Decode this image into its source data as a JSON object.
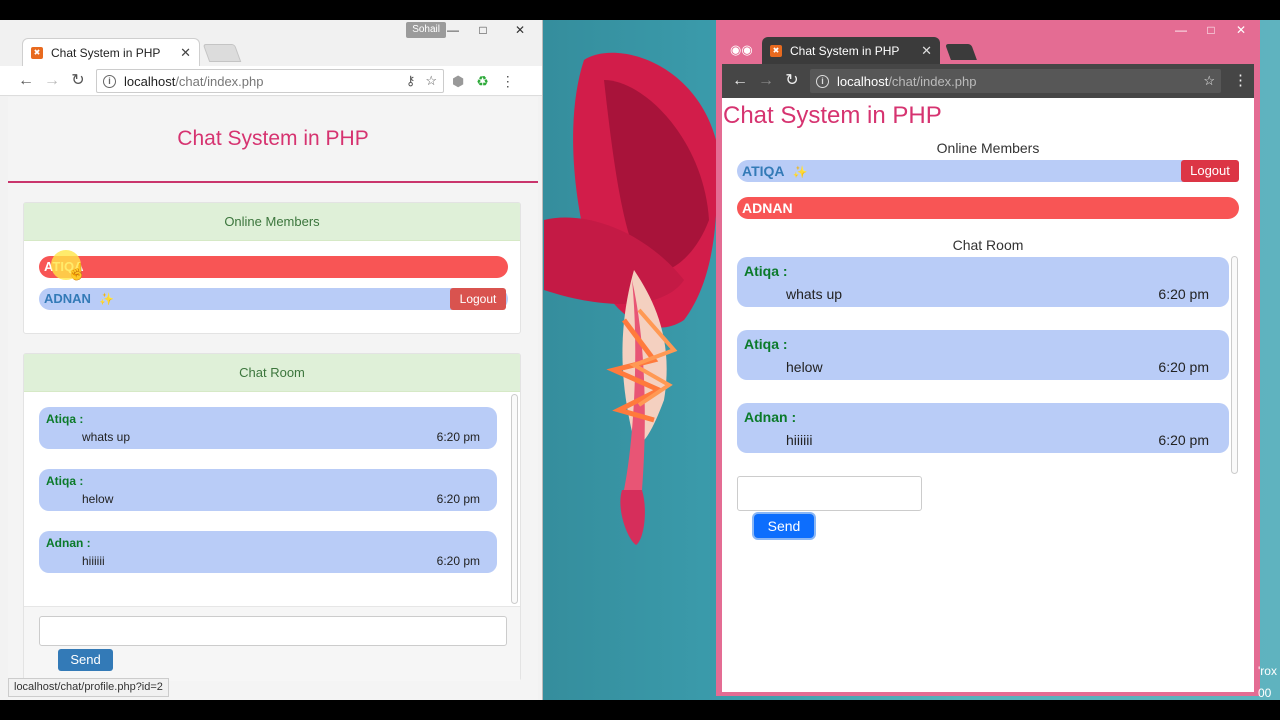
{
  "left_window": {
    "user_badge": "Sohail",
    "tab_title": "Chat System in PHP",
    "url_host": "localhost",
    "url_path": "/chat/index.php",
    "page_title": "Chat System in PHP",
    "online_header": "Online Members",
    "members": [
      {
        "name": "ATIQA"
      },
      {
        "name": "ADNAN"
      }
    ],
    "logout_label": "Logout",
    "chat_header": "Chat Room",
    "messages": [
      {
        "sender": "Atiqa :",
        "text": "whats up",
        "time": "6:20 pm"
      },
      {
        "sender": "Atiqa :",
        "text": "helow",
        "time": "6:20 pm"
      },
      {
        "sender": "Adnan :",
        "text": "hiiiiii",
        "time": "6:20 pm"
      }
    ],
    "send_label": "Send",
    "status_url": "localhost/chat/profile.php?id=2"
  },
  "right_window": {
    "tab_title": "Chat System in PHP",
    "url_host": "localhost",
    "url_path": "/chat/index.php",
    "page_title": "Chat System in PHP",
    "online_header": "Online Members",
    "members": [
      {
        "name": "ATIQA"
      },
      {
        "name": "ADNAN"
      }
    ],
    "logout_label": "Logout",
    "chat_header": "Chat Room",
    "messages": [
      {
        "sender": "Atiqa :",
        "text": "whats up",
        "time": "6:20 pm"
      },
      {
        "sender": "Atiqa :",
        "text": "helow",
        "time": "6:20 pm"
      },
      {
        "sender": "Adnan :",
        "text": "hiiiiii",
        "time": "6:20 pm"
      }
    ],
    "send_label": "Send"
  },
  "edge_text": [
    "'rox",
    "00"
  ],
  "colors": {
    "title": "#d63370",
    "member_active": "#f85555",
    "member_inactive": "#b9ccf7",
    "logout": "#d9534f",
    "send_left": "#337ab7",
    "send_right": "#0d6efd",
    "panel_header": "#dff0d8",
    "sender_name": "#0b7a2a",
    "incognito_frame": "#e46c93"
  },
  "icons": [
    "back-icon",
    "forward-icon",
    "reload-icon",
    "info-icon",
    "key-icon",
    "star-icon",
    "extension-icon",
    "menu-icon",
    "close-icon",
    "minimize-icon",
    "maximize-icon",
    "incognito-icon",
    "sparkle-icon",
    "cursor-icon"
  ]
}
